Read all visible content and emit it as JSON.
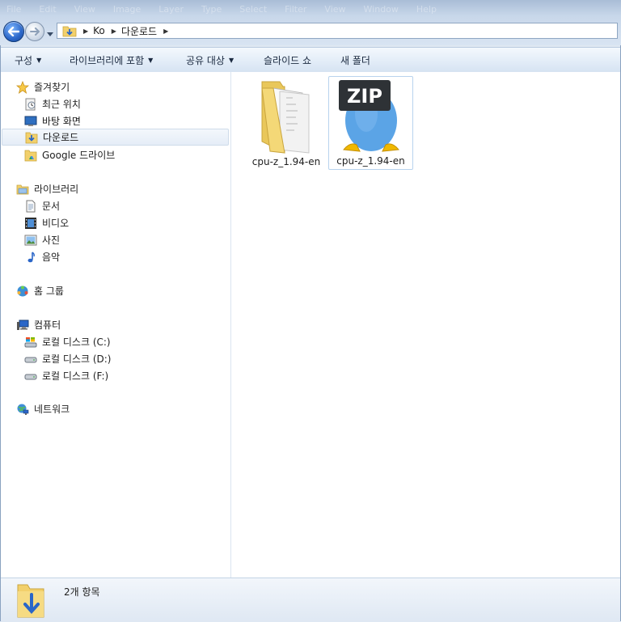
{
  "window": {
    "menu_ghost": [
      "File",
      "Edit",
      "View",
      "Image",
      "Layer",
      "Type",
      "Select",
      "Filter",
      "View",
      "Window",
      "Help"
    ]
  },
  "address_bar": {
    "crumbs": [
      "Ko",
      "다운로드"
    ]
  },
  "command_bar": {
    "organize": "구성",
    "include_in_library": "라이브러리에 포함",
    "share_with": "공유 대상",
    "slide_show": "슬라이드 쇼",
    "new_folder": "새 폴더"
  },
  "nav": {
    "favorites": {
      "label": "즐겨찾기",
      "items": [
        "최근 위치",
        "바탕 화면",
        "다운로드",
        "Google 드라이브"
      ]
    },
    "libraries": {
      "label": "라이브러리",
      "items": [
        "문서",
        "비디오",
        "사진",
        "음악"
      ]
    },
    "homegroup": {
      "label": "홈 그룹"
    },
    "computer": {
      "label": "컴퓨터",
      "items": [
        "로컬 디스크 (C:)",
        "로컬 디스크 (D:)",
        "로컬 디스크 (F:)"
      ]
    },
    "network": {
      "label": "네트워크"
    }
  },
  "files": [
    {
      "name": "cpu-z_1.94-en",
      "type": "folder"
    },
    {
      "name": "cpu-z_1.94-en",
      "type": "zip",
      "badge": "ZIP"
    }
  ],
  "details": {
    "count": "2개 항목"
  },
  "colors": {
    "accent": "#2a66c8",
    "selection_border": "#b8d3ee",
    "folder_yellow": "#f2d06b",
    "zip_blue": "#5ba4e6"
  }
}
